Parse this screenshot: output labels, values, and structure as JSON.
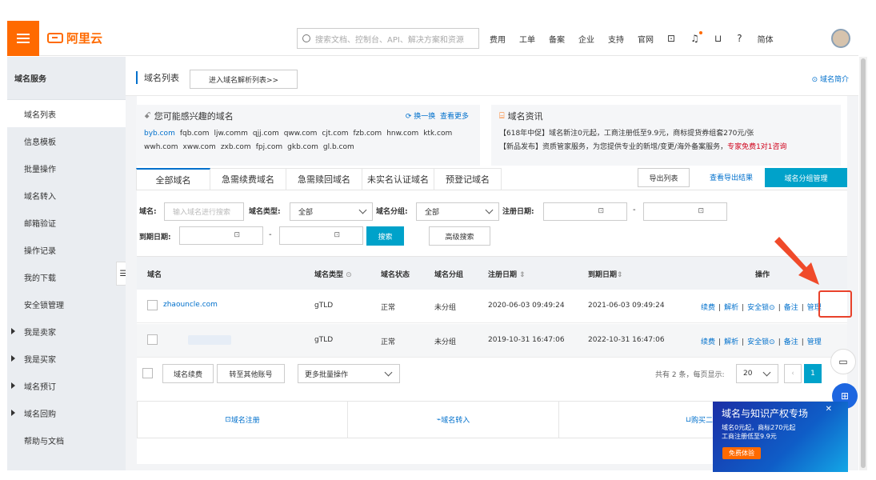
{
  "topbar": {
    "logo": "阿里云",
    "search_placeholder": "搜索文档、控制台、API、解决方案和资源",
    "nav": [
      "费用",
      "工单",
      "备案",
      "企业",
      "支持",
      "官网"
    ],
    "icons": [
      "terminal-icon",
      "bell-icon",
      "cart-icon",
      "help-icon"
    ],
    "lang": "简体"
  },
  "sidebar": {
    "title": "域名服务",
    "items": [
      {
        "label": "域名列表",
        "active": true
      },
      {
        "label": "信息模板"
      },
      {
        "label": "批量操作"
      },
      {
        "label": "域名转入"
      },
      {
        "label": "邮箱验证"
      },
      {
        "label": "操作记录"
      },
      {
        "label": "我的下载"
      },
      {
        "label": "安全锁管理"
      },
      {
        "label": "我是卖家",
        "expandable": true
      },
      {
        "label": "我是买家",
        "expandable": true
      },
      {
        "label": "域名预订",
        "expandable": true
      },
      {
        "label": "域名回购",
        "expandable": true
      },
      {
        "label": "帮助与文档"
      }
    ]
  },
  "header": {
    "title": "域名列表",
    "dns_button": "进入域名解析列表>>",
    "help_link": "域名简介"
  },
  "suggest": {
    "title": "您可能感兴趣的域名",
    "refresh": "换一换",
    "more": "查看更多",
    "row1": [
      "byb.com",
      "fqb.com",
      "ljw.comm",
      "qjj.com",
      "qww.com",
      "cjt.com",
      "fzb.com",
      "hnw.com",
      "ktk.com"
    ],
    "row2": [
      "wwh.com",
      "xww.com",
      "zxb.com",
      "fpj.com",
      "gkb.com",
      "gl.b.com"
    ]
  },
  "news": {
    "title": "域名资讯",
    "line1": "【618年中促】域名新注0元起，工商注册低至9.9元，商标提货券组套270元/张",
    "line2_prefix": "【新品发布】资质管家服务，为您提供专业的新增/变更/海外备案服务，",
    "line2_link": "专家免费1对1咨询"
  },
  "tabs": [
    "全部域名",
    "急需续费域名",
    "急需赎回域名",
    "未实名认证域名",
    "预登记域名"
  ],
  "toolbar": {
    "export": "导出列表",
    "export_results": "查看导出结果",
    "group_manage": "域名分组管理"
  },
  "filters": {
    "domain_label": "域名:",
    "domain_placeholder": "输入域名进行搜索",
    "type_label": "域名类型:",
    "type_value": "全部",
    "group_label": "域名分组:",
    "group_value": "全部",
    "reg_label": "注册日期:",
    "exp_label": "到期日期:",
    "search": "搜索",
    "advanced": "高级搜索"
  },
  "table": {
    "columns": [
      "域名",
      "域名类型",
      "域名状态",
      "域名分组",
      "注册日期",
      "到期日期",
      "操作"
    ],
    "rows": [
      {
        "domain": "zhaouncle.com",
        "type": "gTLD",
        "status": "正常",
        "group": "未分组",
        "reg": "2020-06-03 09:49:24",
        "exp": "2021-06-03 09:49:24",
        "ops": [
          "续费",
          "解析",
          "安全锁",
          "备注",
          "管理"
        ]
      },
      {
        "domain": "",
        "type": "gTLD",
        "status": "正常",
        "group": "未分组",
        "reg": "2019-10-31 16:47:06",
        "exp": "2022-10-31 16:47:06",
        "ops": [
          "续费",
          "解析",
          "安全锁",
          "备注",
          "管理"
        ]
      }
    ]
  },
  "bulk": {
    "renew": "域名续费",
    "transfer": "转至其他账号",
    "more": "更多批量操作",
    "summary": "共有 2 条，每页显示:",
    "page_size": "20",
    "page": "1"
  },
  "services": [
    "域名注册",
    "域名转入",
    "购买二手"
  ],
  "ad": {
    "title": "域名与知识产权专场",
    "line1": "域名0元起，商标270元起",
    "line2": "工商注册低至9.9元",
    "cta": "免费体验"
  }
}
